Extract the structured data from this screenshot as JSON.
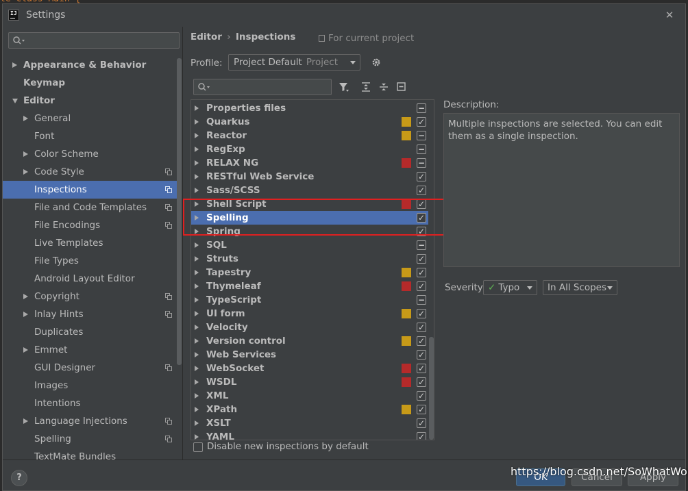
{
  "window": {
    "title": "Settings"
  },
  "left_panel": {
    "items": [
      {
        "label": "Appearance & Behavior",
        "expand": "collapsed",
        "indent": 0,
        "bold": true,
        "project": false
      },
      {
        "label": "Keymap",
        "expand": "none",
        "indent": 0,
        "bold": true,
        "project": false
      },
      {
        "label": "Editor",
        "expand": "expanded",
        "indent": 0,
        "bold": true,
        "project": false
      },
      {
        "label": "General",
        "expand": "collapsed",
        "indent": 1,
        "bold": false,
        "project": false
      },
      {
        "label": "Font",
        "expand": "none",
        "indent": 1,
        "bold": false,
        "project": false
      },
      {
        "label": "Color Scheme",
        "expand": "collapsed",
        "indent": 1,
        "bold": false,
        "project": false
      },
      {
        "label": "Code Style",
        "expand": "collapsed",
        "indent": 1,
        "bold": false,
        "project": true
      },
      {
        "label": "Inspections",
        "expand": "none",
        "indent": 1,
        "bold": false,
        "project": true,
        "selected": true
      },
      {
        "label": "File and Code Templates",
        "expand": "none",
        "indent": 1,
        "bold": false,
        "project": true
      },
      {
        "label": "File Encodings",
        "expand": "none",
        "indent": 1,
        "bold": false,
        "project": true
      },
      {
        "label": "Live Templates",
        "expand": "none",
        "indent": 1,
        "bold": false,
        "project": false
      },
      {
        "label": "File Types",
        "expand": "none",
        "indent": 1,
        "bold": false,
        "project": false
      },
      {
        "label": "Android Layout Editor",
        "expand": "none",
        "indent": 1,
        "bold": false,
        "project": false
      },
      {
        "label": "Copyright",
        "expand": "collapsed",
        "indent": 1,
        "bold": false,
        "project": true
      },
      {
        "label": "Inlay Hints",
        "expand": "collapsed",
        "indent": 1,
        "bold": false,
        "project": true
      },
      {
        "label": "Duplicates",
        "expand": "none",
        "indent": 1,
        "bold": false,
        "project": false
      },
      {
        "label": "Emmet",
        "expand": "collapsed",
        "indent": 1,
        "bold": false,
        "project": false
      },
      {
        "label": "GUI Designer",
        "expand": "none",
        "indent": 1,
        "bold": false,
        "project": true
      },
      {
        "label": "Images",
        "expand": "none",
        "indent": 1,
        "bold": false,
        "project": false
      },
      {
        "label": "Intentions",
        "expand": "none",
        "indent": 1,
        "bold": false,
        "project": false
      },
      {
        "label": "Language Injections",
        "expand": "collapsed",
        "indent": 1,
        "bold": false,
        "project": true
      },
      {
        "label": "Spelling",
        "expand": "none",
        "indent": 1,
        "bold": false,
        "project": true
      },
      {
        "label": "TextMate Bundles",
        "expand": "none",
        "indent": 1,
        "bold": false,
        "project": false
      }
    ]
  },
  "breadcrumb": {
    "parent": "Editor",
    "current": "Inspections",
    "separator": "›"
  },
  "for_current_project": "For current project",
  "profile": {
    "label": "Profile:",
    "value": "Project Default",
    "sub": "Project"
  },
  "inspections": [
    {
      "name": "Properties files",
      "severity": "",
      "check": "partial"
    },
    {
      "name": "Quarkus",
      "severity": "#c79a18",
      "check": "checked"
    },
    {
      "name": "Reactor",
      "severity": "#c79a18",
      "check": "partial"
    },
    {
      "name": "RegExp",
      "severity": "",
      "check": "partial"
    },
    {
      "name": "RELAX NG",
      "severity": "#b52a2a",
      "check": "partial"
    },
    {
      "name": "RESTful Web Service",
      "severity": "",
      "check": "checked"
    },
    {
      "name": "Sass/SCSS",
      "severity": "",
      "check": "checked"
    },
    {
      "name": "Shell Script",
      "severity": "#b52a2a",
      "check": "checked"
    },
    {
      "name": "Spelling",
      "severity": "",
      "check": "checked",
      "selected": true
    },
    {
      "name": "Spring",
      "severity": "",
      "check": "checked"
    },
    {
      "name": "SQL",
      "severity": "",
      "check": "partial"
    },
    {
      "name": "Struts",
      "severity": "",
      "check": "checked"
    },
    {
      "name": "Tapestry",
      "severity": "#c79a18",
      "check": "checked"
    },
    {
      "name": "Thymeleaf",
      "severity": "#b52a2a",
      "check": "checked"
    },
    {
      "name": "TypeScript",
      "severity": "",
      "check": "partial"
    },
    {
      "name": "UI form",
      "severity": "#c79a18",
      "check": "checked"
    },
    {
      "name": "Velocity",
      "severity": "",
      "check": "checked"
    },
    {
      "name": "Version control",
      "severity": "#c79a18",
      "check": "checked"
    },
    {
      "name": "Web Services",
      "severity": "",
      "check": "checked"
    },
    {
      "name": "WebSocket",
      "severity": "#b52a2a",
      "check": "checked"
    },
    {
      "name": "WSDL",
      "severity": "#b52a2a",
      "check": "checked"
    },
    {
      "name": "XML",
      "severity": "",
      "check": "checked"
    },
    {
      "name": "XPath",
      "severity": "#c79a18",
      "check": "checked"
    },
    {
      "name": "XSLT",
      "severity": "",
      "check": "checked"
    },
    {
      "name": "YAML",
      "severity": "",
      "check": "checked"
    }
  ],
  "disable_new_label": "Disable new inspections by default",
  "description": {
    "label": "Description:",
    "text": "Multiple inspections are selected. You can edit them as a single inspection."
  },
  "severity": {
    "label": "Severity:",
    "value": "Typo",
    "scope": "In All Scopes"
  },
  "footer": {
    "help": "?",
    "ok": "OK",
    "cancel": "Cancel",
    "apply": "Apply"
  },
  "watermark": "https://blog.csdn.net/SoWhatWorld",
  "colors": {
    "selection": "#4b6eaf",
    "background": "#3c3f41",
    "highlight_box": "#e02020"
  }
}
